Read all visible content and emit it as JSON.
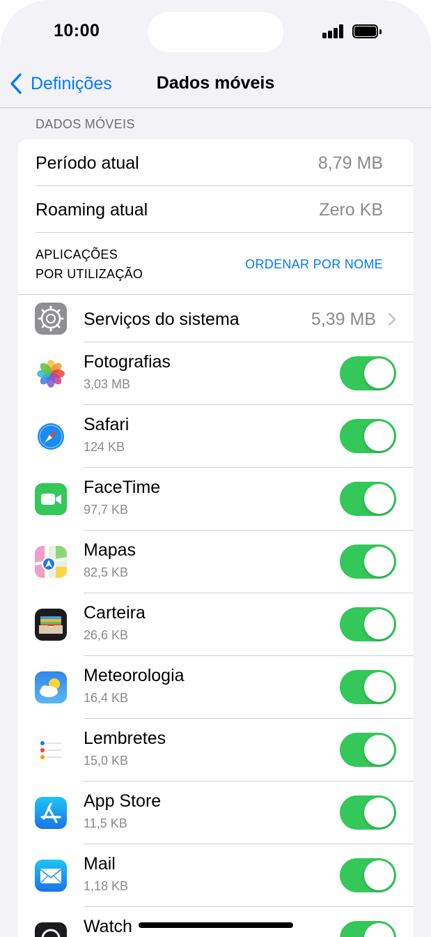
{
  "status_bar": {
    "time": "10:00"
  },
  "nav": {
    "back_label": "Definições",
    "title": "Dados móveis"
  },
  "section_header": "DADOS MÓVEIS",
  "usage": {
    "current_period_label": "Período atual",
    "current_period_value": "8,79 MB",
    "current_roaming_label": "Roaming atual",
    "current_roaming_value": "Zero KB"
  },
  "apps_header": {
    "line1": "APLICAÇÕES",
    "line2": "POR UTILIZAÇÃO",
    "sort_label": "ORDENAR POR NOME"
  },
  "system_services": {
    "label": "Serviços do sistema",
    "value": "5,39 MB"
  },
  "apps": [
    {
      "name": "Fotografias",
      "size": "3,03 MB",
      "icon": "photos-icon",
      "enabled": true
    },
    {
      "name": "Safari",
      "size": "124 KB",
      "icon": "safari-icon",
      "enabled": true
    },
    {
      "name": "FaceTime",
      "size": "97,7 KB",
      "icon": "facetime-icon",
      "enabled": true
    },
    {
      "name": "Mapas",
      "size": "82,5 KB",
      "icon": "maps-icon",
      "enabled": true
    },
    {
      "name": "Carteira",
      "size": "26,6 KB",
      "icon": "wallet-icon",
      "enabled": true
    },
    {
      "name": "Meteorologia",
      "size": "16,4 KB",
      "icon": "weather-icon",
      "enabled": true
    },
    {
      "name": "Lembretes",
      "size": "15,0 KB",
      "icon": "reminders-icon",
      "enabled": true
    },
    {
      "name": "App Store",
      "size": "11,5 KB",
      "icon": "app-store-icon",
      "enabled": true
    },
    {
      "name": "Mail",
      "size": "1,18 KB",
      "icon": "mail-icon",
      "enabled": true
    },
    {
      "name": "Watch",
      "size": "",
      "icon": "watch-icon",
      "enabled": true
    }
  ],
  "colors": {
    "accent": "#007aff",
    "toggle_on": "#34c759",
    "background": "#f2f2f7"
  }
}
